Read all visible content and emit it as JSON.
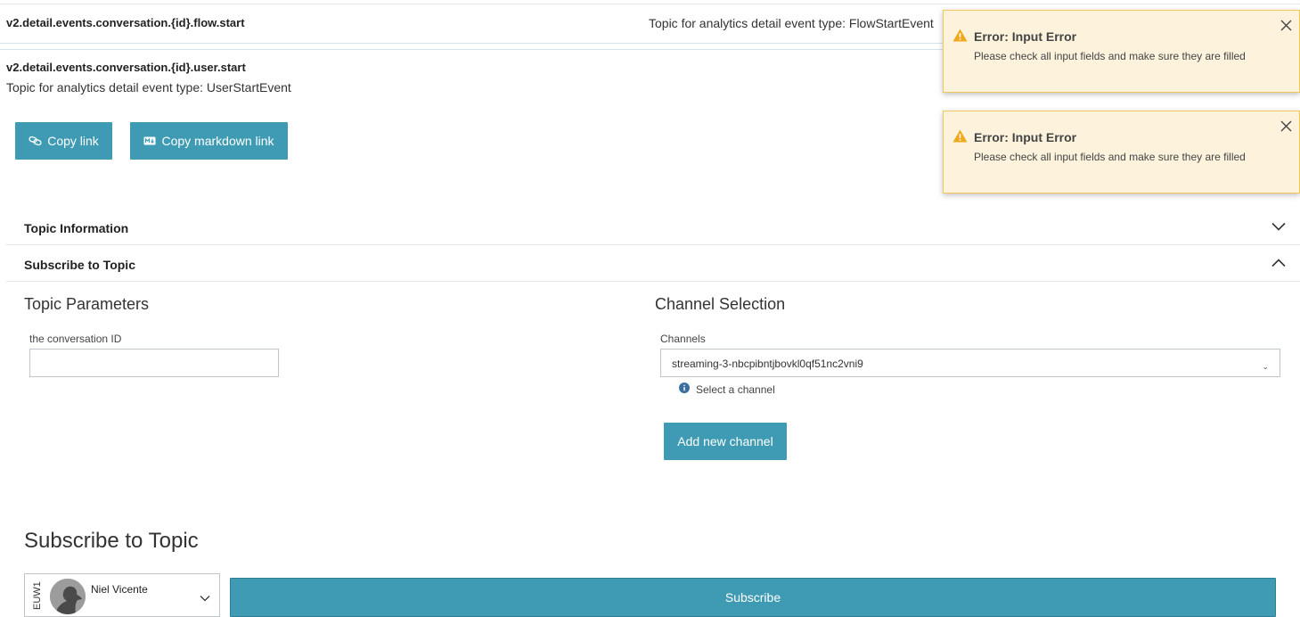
{
  "topic_rows": [
    {
      "name": "v2.detail.events.conversation.{id}.flow.start",
      "description": "Topic for analytics detail event type: FlowStartEvent"
    }
  ],
  "current_topic": {
    "name": "v2.detail.events.conversation.{id}.user.start",
    "description": "Topic for analytics detail event type: UserStartEvent"
  },
  "actions": {
    "copy_link_label": "Copy link",
    "copy_markdown_label": "Copy markdown link"
  },
  "accordions": [
    {
      "label": "Topic Information",
      "state": "collapsed"
    },
    {
      "label": "Subscribe to Topic",
      "state": "expanded"
    }
  ],
  "topic_parameters": {
    "title": "Topic Parameters",
    "field_label": "the conversation ID",
    "field_value": ""
  },
  "channel_selection": {
    "title": "Channel Selection",
    "field_label": "Channels",
    "selected": "streaming-3-nbcpibntjbovkl0qf51nc2vni9",
    "hint": "Select a channel",
    "add_button": "Add new channel"
  },
  "subscribe": {
    "title": "Subscribe to Topic",
    "region": "EUW1",
    "user_name": "Niel Vicente",
    "button": "Subscribe"
  },
  "toasts": [
    {
      "title": "Error: Input Error",
      "message": "Please check all input fields and make sure they are filled"
    },
    {
      "title": "Error: Input Error",
      "message": "Please check all input fields and make sure they are filled"
    }
  ],
  "colors": {
    "primary": "#3f9bb3",
    "toast_bg": "#fdf3dd",
    "toast_border": "#f2c75c",
    "warning": "#f0a81c",
    "info": "#3a6fa0"
  }
}
